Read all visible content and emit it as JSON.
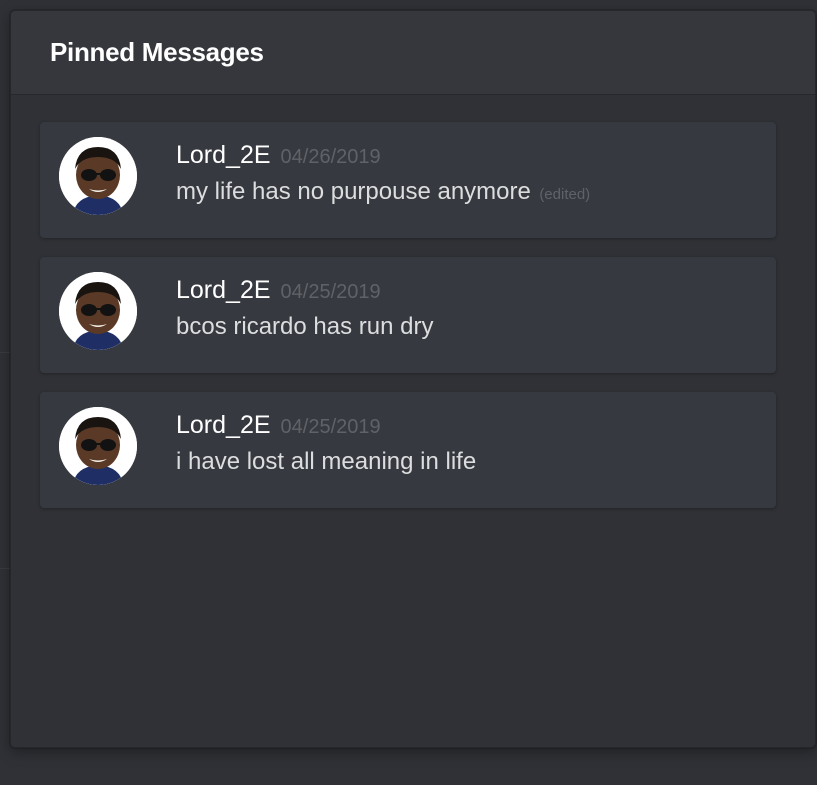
{
  "popout": {
    "title": "Pinned Messages"
  },
  "messages": [
    {
      "author": "Lord_2E",
      "timestamp": "04/26/2019",
      "text": "my life has no purpouse anymore",
      "edited": "(edited)"
    },
    {
      "author": "Lord_2E",
      "timestamp": "04/25/2019",
      "text": "bcos ricardo has run dry",
      "edited": ""
    },
    {
      "author": "Lord_2E",
      "timestamp": "04/25/2019",
      "text": "i have lost all meaning in life",
      "edited": ""
    }
  ],
  "colors": {
    "background": "#2f3136",
    "header": "#35373c",
    "card": "#36393f",
    "author": "#ffffff",
    "timestamp": "#5f6268",
    "text": "#dcddde"
  },
  "icons": {
    "avatar": "user-avatar-photo"
  }
}
